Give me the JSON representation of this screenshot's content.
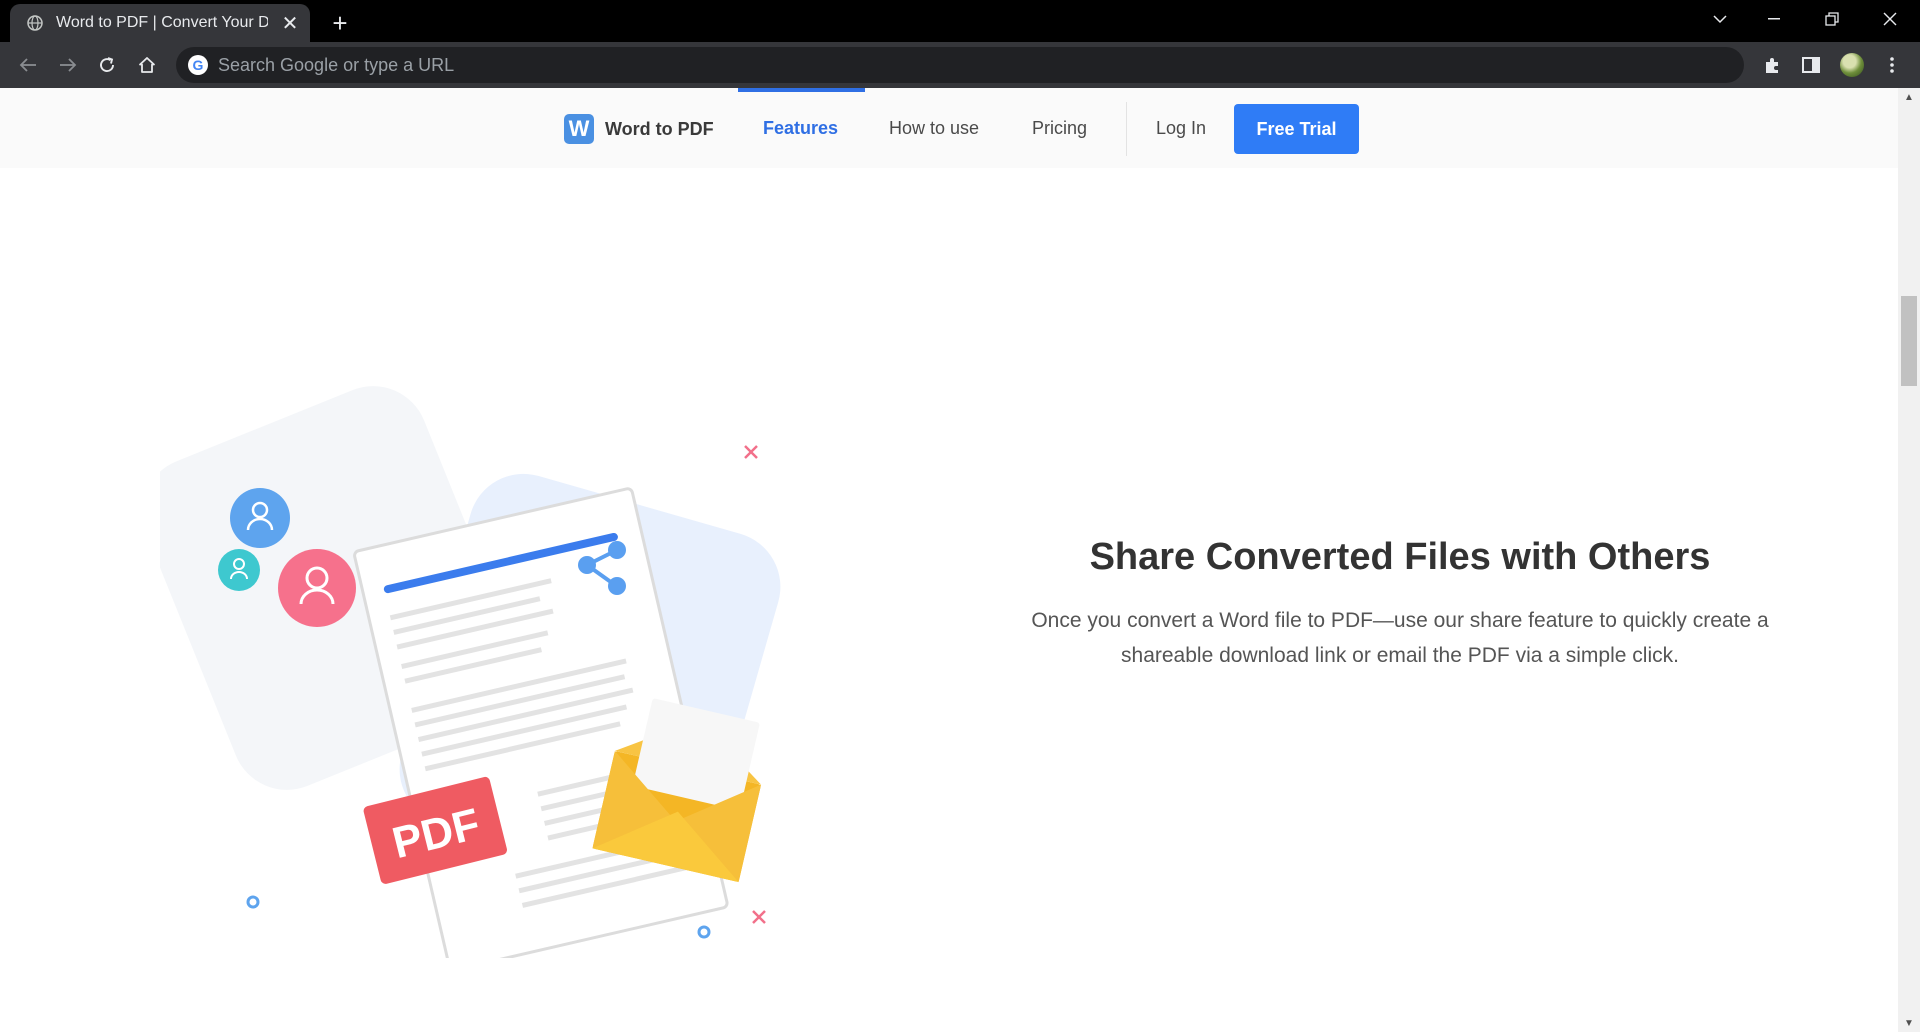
{
  "browser": {
    "tab_title": "Word to PDF | Convert Your Doc",
    "omnibox_placeholder": "Search Google or type a URL",
    "omnibox_badge": "G"
  },
  "site": {
    "logo_mark": "W",
    "logo_text": "Word to PDF",
    "nav": {
      "features": "Features",
      "how_to_use": "How to use",
      "pricing": "Pricing",
      "login": "Log In",
      "cta": "Free Trial"
    },
    "accent_color": "#2f7cf6"
  },
  "section": {
    "title": "Share Converted Files with Others",
    "description": "Once you convert a Word file to PDF—use our share feature to quickly create a shareable download link or email the PDF via a simple click.",
    "badge_text": "PDF"
  }
}
